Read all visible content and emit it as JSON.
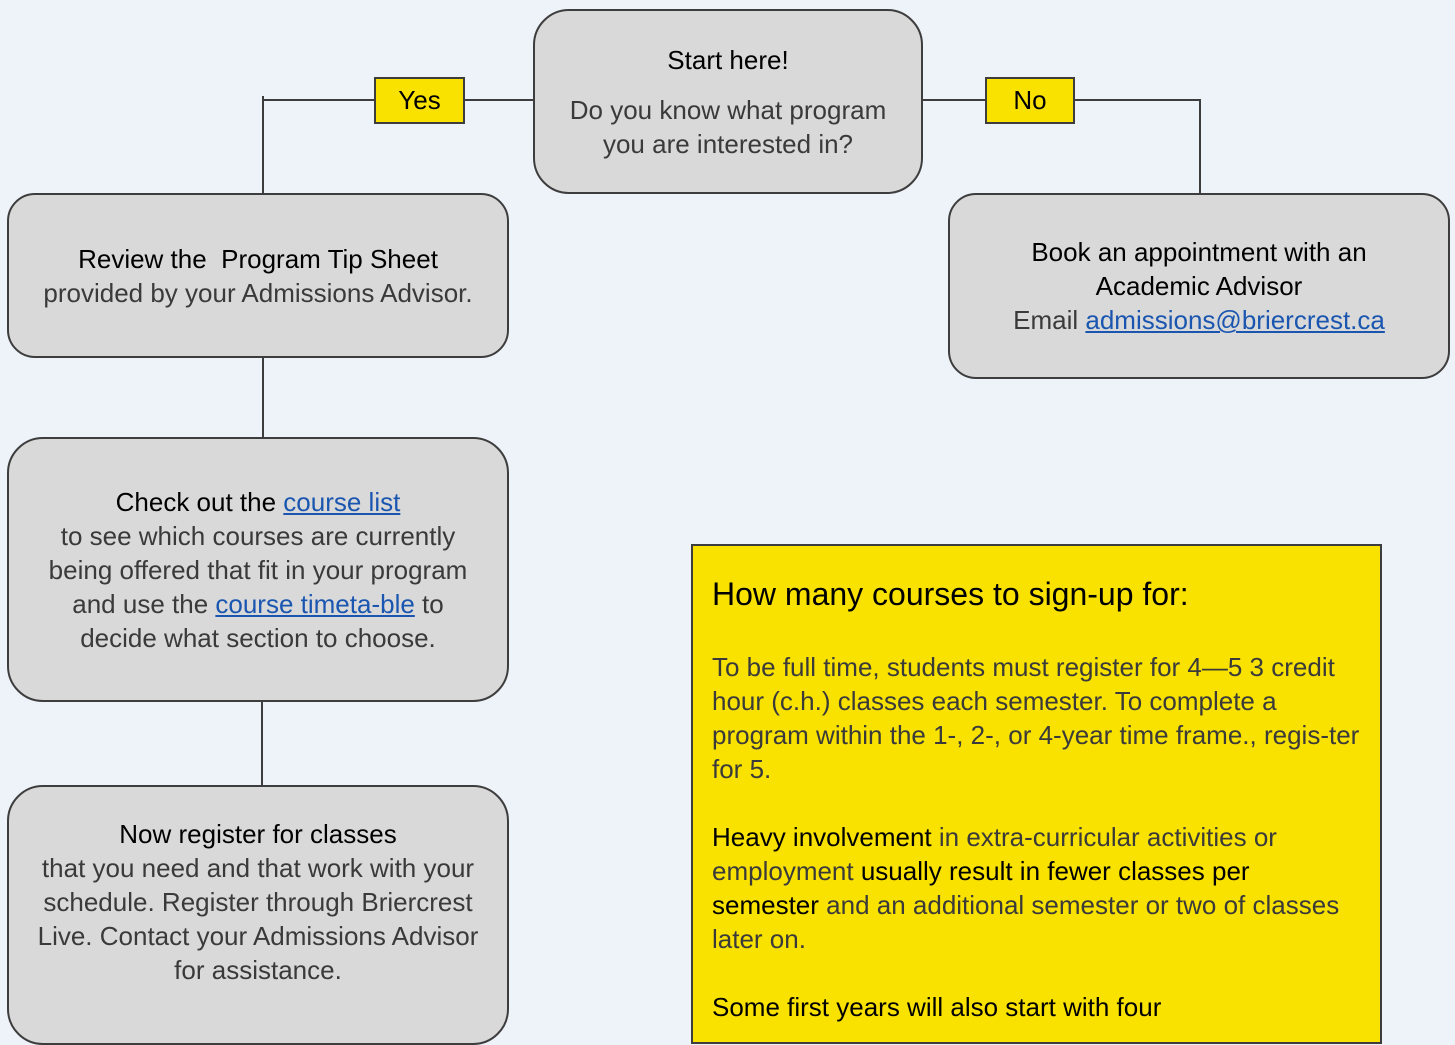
{
  "start_box": {
    "heading": "Start here!",
    "question": "Do you know what program you are interested in?"
  },
  "branch_yes": {
    "label": "Yes"
  },
  "branch_no": {
    "label": "No"
  },
  "review_box": {
    "heading": "Review the  Program Tip Sheet",
    "body": "provided by your Admissions Advisor."
  },
  "advisor_box": {
    "heading": "Book an appointment with an Academic Advisor",
    "email_prefix": "Email ",
    "email_link": "admissions@briercrest.ca"
  },
  "course_box": {
    "heading": "Check out the ",
    "course_list_link": "course list",
    "body_1": "to see which courses are currently being offered that fit in your program and use the ",
    "timetable_link": "course timeta-ble",
    "body_2": " to decide what section to choose."
  },
  "register_box": {
    "heading": "Now register for classes",
    "body": "that you need and that work with your schedule. Register through Briercrest Live. Contact your Admissions Advisor for assistance."
  },
  "info_panel": {
    "title": "How many courses to sign-up for:",
    "para1": "To be full time, students must register for 4—5  3 credit hour (c.h.) classes each semester. To complete a program within the 1-, 2-, or 4-year time frame., regis-ter for 5.",
    "para2_bold1": "Heavy involvement",
    "para2_text1": " in extra-curricular activities or employment ",
    "para2_bold2": "usually result in fewer classes per semester",
    "para2_text2": " and an additional semester or two of classes later on.",
    "para3_bold": "Some first years will also start with four"
  },
  "colors": {
    "background": "#eef3fa",
    "box_fill": "#d9d9d9",
    "accent_yellow": "#f9e200",
    "link_blue": "#1a56b0"
  }
}
